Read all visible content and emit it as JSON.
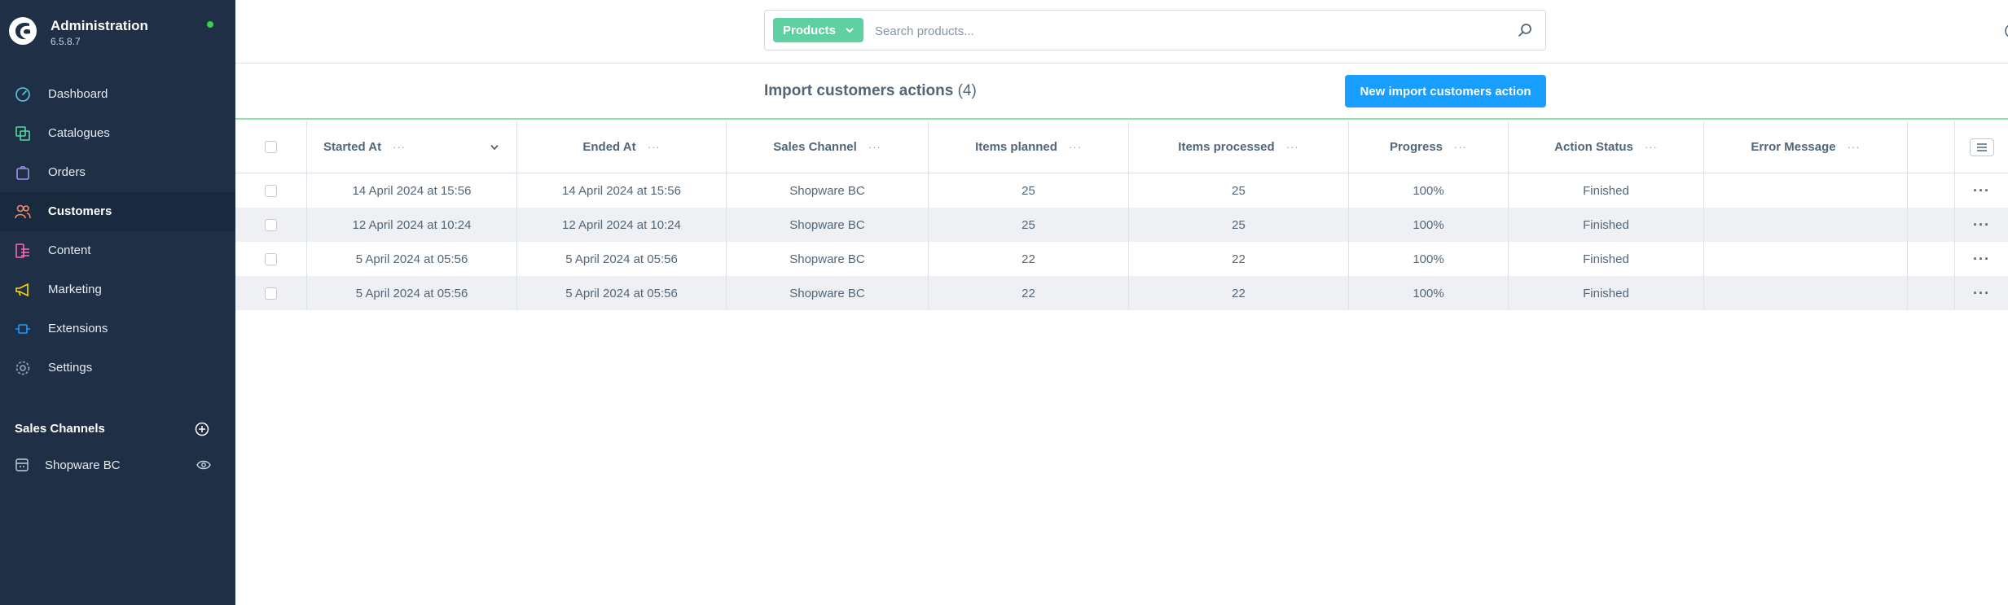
{
  "brand": {
    "title": "Administration",
    "version": "6.5.8.7",
    "online_color": "#37d046"
  },
  "sidebar": {
    "items": [
      {
        "label": "Dashboard",
        "icon": "dashboard-icon",
        "color": "#5ec8e4"
      },
      {
        "label": "Catalogues",
        "icon": "catalogues-icon",
        "color": "#57d9a3"
      },
      {
        "label": "Orders",
        "icon": "orders-icon",
        "color": "#a092f0"
      },
      {
        "label": "Customers",
        "icon": "customers-icon",
        "color": "#f88962",
        "active": true
      },
      {
        "label": "Content",
        "icon": "content-icon",
        "color": "#ff68b4"
      },
      {
        "label": "Marketing",
        "icon": "marketing-icon",
        "color": "#ffd700"
      },
      {
        "label": "Extensions",
        "icon": "extensions-icon",
        "color": "#189eff"
      },
      {
        "label": "Settings",
        "icon": "settings-icon",
        "color": "#9aa8b5"
      }
    ],
    "sales_channels": {
      "title": "Sales Channels",
      "items": [
        {
          "label": "Shopware BC"
        }
      ]
    }
  },
  "search": {
    "type_label": "Products",
    "placeholder": "Search products..."
  },
  "page": {
    "title": "Import customers actions",
    "count": "(4)",
    "new_button_label": "New import customers action"
  },
  "grid": {
    "columns": [
      "Started At",
      "Ended At",
      "Sales Channel",
      "Items planned",
      "Items processed",
      "Progress",
      "Action Status",
      "Error Message"
    ],
    "rows": [
      {
        "started": "14 April 2024 at 15:56",
        "ended": "14 April 2024 at 15:56",
        "channel": "Shopware BC",
        "planned": "25",
        "processed": "25",
        "progress": "100%",
        "status": "Finished",
        "error": ""
      },
      {
        "started": "12 April 2024 at 10:24",
        "ended": "12 April 2024 at 10:24",
        "channel": "Shopware BC",
        "planned": "25",
        "processed": "25",
        "progress": "100%",
        "status": "Finished",
        "error": ""
      },
      {
        "started": "5 April 2024 at 05:56",
        "ended": "5 April 2024 at 05:56",
        "channel": "Shopware BC",
        "planned": "22",
        "processed": "22",
        "progress": "100%",
        "status": "Finished",
        "error": ""
      },
      {
        "started": "5 April 2024 at 05:56",
        "ended": "5 April 2024 at 05:56",
        "channel": "Shopware BC",
        "planned": "22",
        "processed": "22",
        "progress": "100%",
        "status": "Finished",
        "error": ""
      }
    ],
    "row_action_glyph": "···",
    "header_dots": "···"
  }
}
